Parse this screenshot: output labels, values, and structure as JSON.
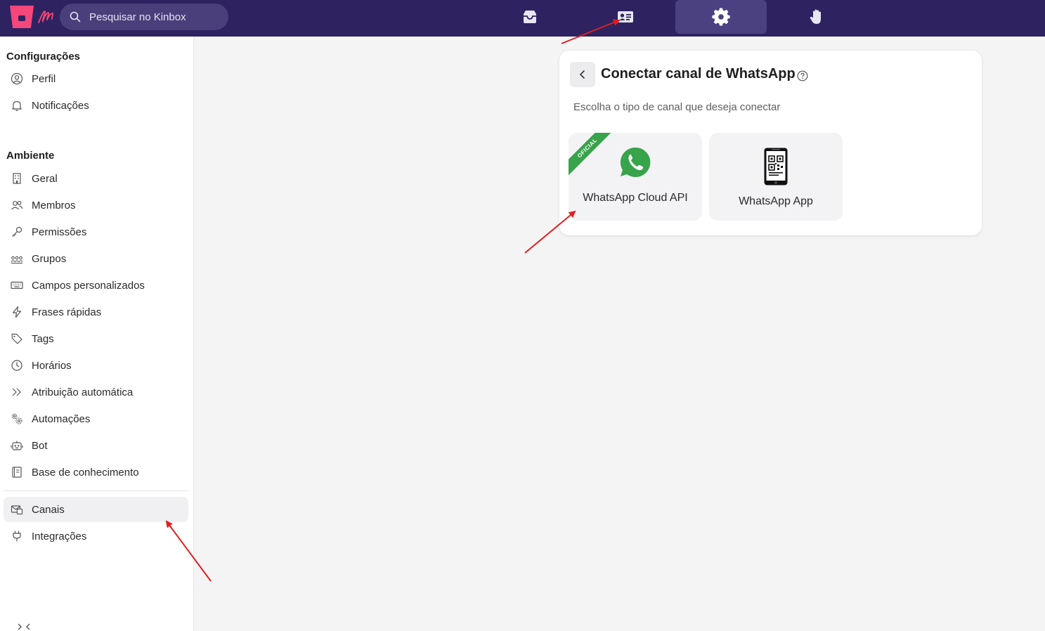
{
  "topbar": {
    "search_placeholder": "Pesquisar no Kinbox",
    "nav": [
      {
        "icon": "inbox-icon"
      },
      {
        "icon": "contact-card-icon"
      },
      {
        "icon": "gear-icon",
        "active": true
      },
      {
        "icon": "hand-icon"
      }
    ]
  },
  "sidebar": {
    "section1_title": "Configurações",
    "section1_items": [
      {
        "label": "Perfil",
        "icon": "user-circle-icon"
      },
      {
        "label": "Notificações",
        "icon": "bell-icon"
      }
    ],
    "section2_title": "Ambiente",
    "section2_items": [
      {
        "label": "Geral",
        "icon": "building-icon"
      },
      {
        "label": "Membros",
        "icon": "users-icon"
      },
      {
        "label": "Permissões",
        "icon": "key-icon"
      },
      {
        "label": "Grupos",
        "icon": "group-icon"
      },
      {
        "label": "Campos personalizados",
        "icon": "keyboard-icon"
      },
      {
        "label": "Frases rápidas",
        "icon": "lightning-icon"
      },
      {
        "label": "Tags",
        "icon": "tag-icon"
      },
      {
        "label": "Horários",
        "icon": "clock-icon"
      },
      {
        "label": "Atribuição automática",
        "icon": "double-chevron-icon"
      },
      {
        "label": "Automações",
        "icon": "gears-icon"
      },
      {
        "label": "Bot",
        "icon": "robot-icon"
      },
      {
        "label": "Base de conhecimento",
        "icon": "book-icon"
      }
    ],
    "section3_items": [
      {
        "label": "Canais",
        "icon": "channels-icon",
        "active": true
      },
      {
        "label": "Integrações",
        "icon": "plug-icon"
      }
    ]
  },
  "card": {
    "title": "Conectar canal de WhatsApp",
    "subtitle": "Escolha o tipo de canal que deseja conectar",
    "options": [
      {
        "label": "WhatsApp Cloud API",
        "ribbon": "OFICIAL",
        "icon": "whatsapp-icon"
      },
      {
        "label": "WhatsApp App",
        "icon": "phone-qr-icon"
      }
    ]
  },
  "colors": {
    "topbar": "#2e2261",
    "brand_pink": "#f6477a",
    "whatsapp_green": "#37a34a",
    "annotation_red": "#e02020"
  }
}
